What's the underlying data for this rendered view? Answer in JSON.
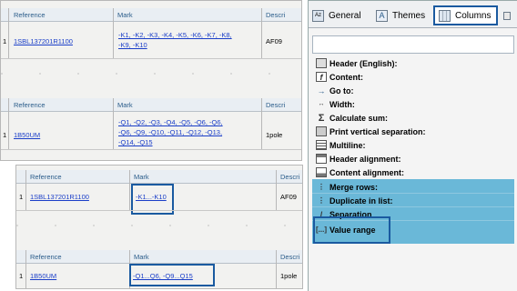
{
  "top_table": {
    "headers": {
      "reference": "Reference",
      "mark": "Mark",
      "description": "Descri"
    },
    "row1": {
      "num": "1",
      "reference": "1SBL137201R1100",
      "mark_line1": "-K1, -K2, -K3, -K4, -K5, -K6, -K7, -K8,",
      "mark_line2": "-K9, -K10",
      "description": "AF09"
    },
    "headers2": {
      "reference": "Reference",
      "mark": "Mark",
      "description": "Descri"
    },
    "row2": {
      "num": "1",
      "reference": "1B50UM",
      "mark_line1": "-Q1, -Q2, -Q3, -Q4, -Q5, -Q6, -Q6,",
      "mark_line2": "-Q6, -Q9, -Q10, -Q11, -Q12, -Q13,",
      "mark_line3": "-Q14, -Q15",
      "description": "1pole"
    }
  },
  "bottom_table": {
    "headers": {
      "reference": "Reference",
      "mark": "Mark",
      "description": "Descri"
    },
    "row1": {
      "num": "1",
      "reference": "1SBL137201R1100",
      "mark": "-K1...-K10",
      "description": "AF09"
    },
    "headers2": {
      "reference": "Reference",
      "mark": "Mark",
      "description": "Descri"
    },
    "row2": {
      "num": "1",
      "reference": "1B50UM",
      "mark": "-Q1...Q6, -Q9...Q15",
      "description": "1pole"
    }
  },
  "properties_panel": {
    "tabs": {
      "general": "General",
      "themes": "Themes",
      "columns": "Columns"
    },
    "properties": {
      "header": "Header (English):",
      "content": "Content:",
      "goto": "Go to:",
      "width": "Width:",
      "calculate_sum": "Calculate sum:",
      "print_vertical": "Print vertical separation:",
      "multiline": "Multiline:",
      "header_alignment": "Header alignment:",
      "content_alignment": "Content alignment:",
      "merge_rows": "Merge rows:",
      "duplicate_in_list": "Duplicate in list:",
      "separation": "Separation",
      "value_range": "Value range"
    },
    "icons": {
      "general": "general-tab-icon",
      "themes": "themes-tab-icon",
      "columns": "columns-tab-icon"
    },
    "colors": {
      "selection": "#6ab8d8",
      "highlight_border": "#1a5aa0",
      "link": "#1a3ec8"
    }
  }
}
